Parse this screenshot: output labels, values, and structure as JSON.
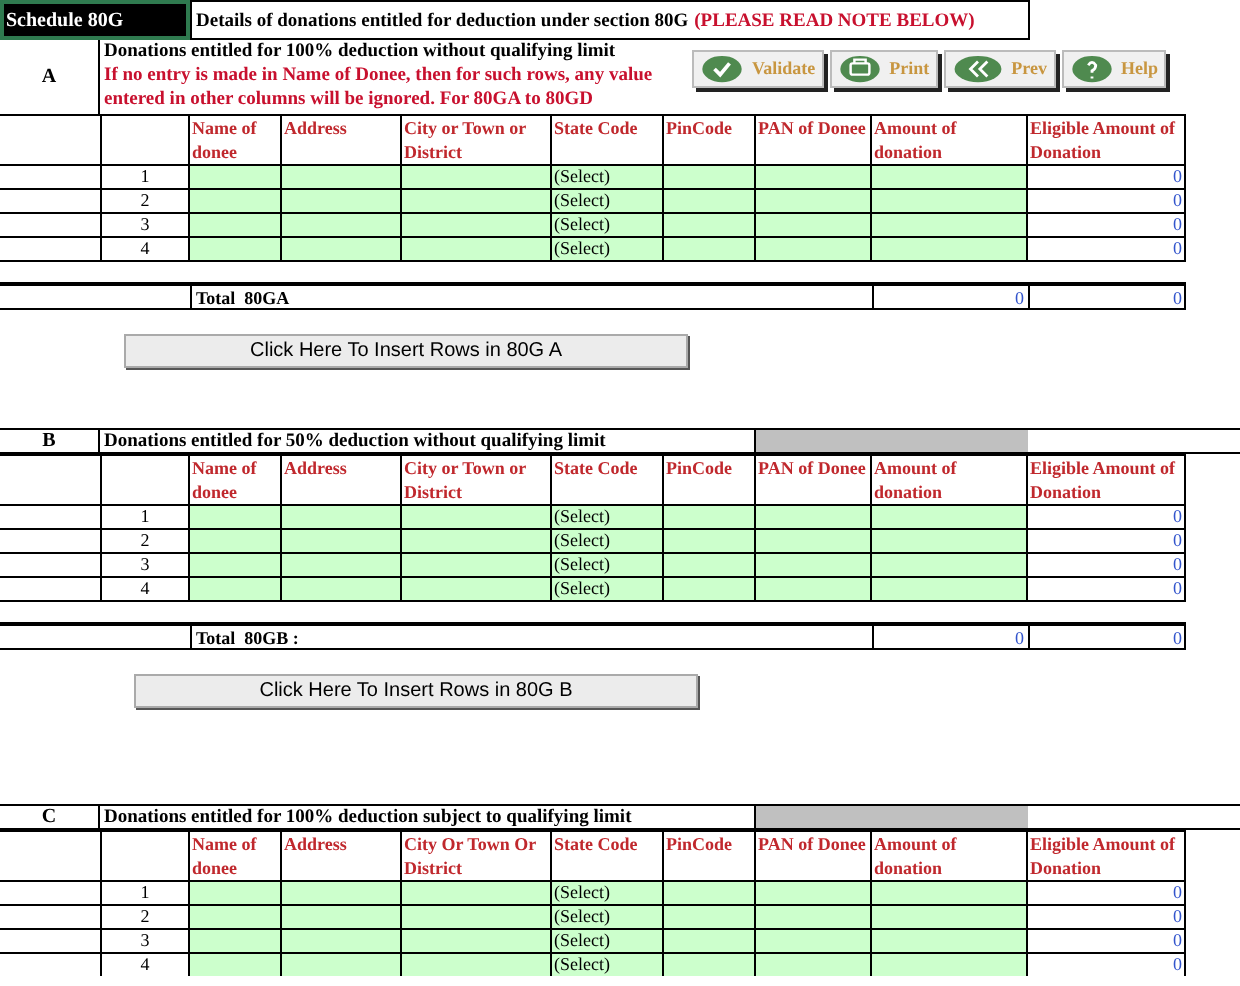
{
  "schedule_label": "Schedule 80G",
  "title": "Details of donations entitled for deduction under section 80G",
  "title_note": "(PLEASE READ NOTE BELOW)",
  "toolbar": [
    {
      "kind": "check",
      "label": "Validate"
    },
    {
      "kind": "print",
      "label": "Print"
    },
    {
      "kind": "prev",
      "label": "Prev"
    },
    {
      "kind": "help",
      "label": "Help"
    }
  ],
  "sections": [
    {
      "letter": "A",
      "title": "Donations entitled for 100% deduction without qualifying limit",
      "note": "If no entry is made in Name of Donee, then for such rows, any value entered in other columns will be ignored. For 80GA to 80GD",
      "shaded": false,
      "columns": [
        "Name of donee",
        "Address",
        "City or Town or District",
        "State Code",
        "PinCode",
        "PAN of Donee",
        "Amount of donation",
        "Eligible Amount of Donation"
      ],
      "rows": [
        {
          "number": "1",
          "state_code": "(Select)",
          "eligible": "0"
        },
        {
          "number": "2",
          "state_code": "(Select)",
          "eligible": "0"
        },
        {
          "number": "3",
          "state_code": "(Select)",
          "eligible": "0"
        },
        {
          "number": "4",
          "state_code": "(Select)",
          "eligible": "0"
        }
      ],
      "total": {
        "label": "Total  80GA",
        "amount": "0",
        "eligible": "0"
      },
      "insert_button": "Click Here To Insert Rows in 80G A"
    },
    {
      "letter": "B",
      "title": "Donations entitled for 50% deduction without qualifying limit",
      "shaded": true,
      "columns": [
        "Name of donee",
        "Address",
        "City or Town or District",
        "State Code",
        "PinCode",
        "PAN of Donee",
        "Amount of donation",
        "Eligible Amount of Donation"
      ],
      "rows": [
        {
          "number": "1",
          "state_code": "(Select)",
          "eligible": "0"
        },
        {
          "number": "2",
          "state_code": "(Select)",
          "eligible": "0"
        },
        {
          "number": "3",
          "state_code": "(Select)",
          "eligible": "0"
        },
        {
          "number": "4",
          "state_code": "(Select)",
          "eligible": "0"
        }
      ],
      "total": {
        "label": "Total  80GB :",
        "amount": "0",
        "eligible": "0"
      },
      "insert_button": "Click Here To Insert Rows in 80G B"
    },
    {
      "letter": "C",
      "title": "Donations entitled for 100% deduction subject to qualifying limit",
      "shaded": true,
      "columns": [
        "Name of donee",
        "Address",
        "City Or Town Or District",
        "State Code",
        "PinCode",
        "PAN of Donee",
        "Amount of donation",
        "Eligible Amount of Donation"
      ],
      "rows": [
        {
          "number": "1",
          "state_code": "(Select)",
          "eligible": "0"
        },
        {
          "number": "2",
          "state_code": "(Select)",
          "eligible": "0"
        },
        {
          "number": "3",
          "state_code": "(Select)",
          "eligible": "0"
        },
        {
          "number": "4",
          "state_code": "(Select)",
          "eligible": "0"
        }
      ]
    }
  ]
}
